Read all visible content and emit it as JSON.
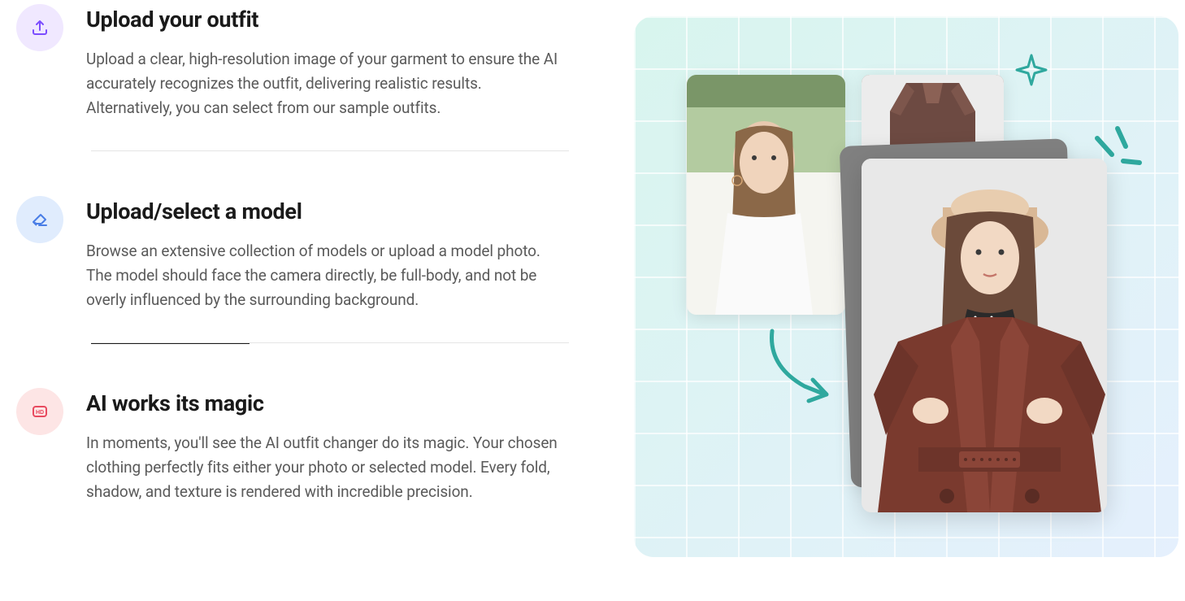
{
  "steps": [
    {
      "title": "Upload your outfit",
      "description": "Upload a clear, high-resolution image of your garment to ensure the AI accurately recognizes the outfit, delivering realistic results. Alternatively, you can select from our sample outfits.",
      "icon": "upload-icon"
    },
    {
      "title": "Upload/select a model",
      "description": "Browse an extensive collection of models or upload a model photo. The model should face the camera directly, be full-body, and not be overly influenced by the surrounding background.",
      "icon": "eraser-icon"
    },
    {
      "title": "AI works its magic",
      "description": "In moments, you'll see the AI outfit changer do its magic. Your chosen clothing perfectly fits either your photo or selected model. Every fold, shadow, and texture is rendered with incredible precision.",
      "icon": "hd-icon"
    }
  ]
}
